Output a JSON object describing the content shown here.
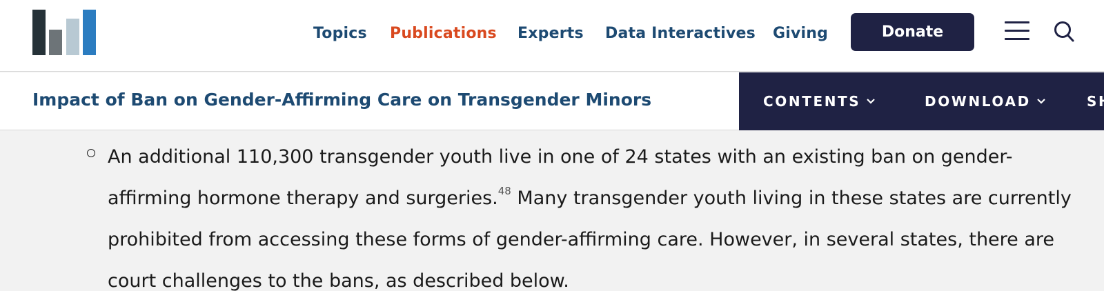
{
  "header": {
    "nav": [
      {
        "label": "Topics",
        "active": false
      },
      {
        "label": "Publications",
        "active": true
      },
      {
        "label": "Experts",
        "active": false
      },
      {
        "label": "Data Interactives",
        "active": false
      },
      {
        "label": "Giving",
        "active": false
      }
    ],
    "donate_label": "Donate",
    "icons": [
      "logo",
      "hamburger-menu-icon",
      "search-icon"
    ]
  },
  "subheader": {
    "title": "Impact of Ban on Gender-Affirming Care on Transgender Minors",
    "actions": [
      {
        "label": "CONTENTS"
      },
      {
        "label": "DOWNLOAD"
      },
      {
        "label": "SH"
      }
    ]
  },
  "content": {
    "bullet_text_1": "An additional 110,300 transgender youth live in one of 24 states with an existing ban on gender-affirming hormone therapy and surgeries.",
    "footnote": "48",
    "bullet_text_2": " Many transgender youth living in these states are currently prohibited from accessing these forms of gender-affirming care. However, in several states, there are court challenges to the bans, as described below."
  },
  "colors": {
    "nav_text": "#1d4a72",
    "nav_active": "#d9491f",
    "brand_navy": "#1f2244",
    "page_bg": "#f2f2f2",
    "logo_bars": [
      "#263238",
      "#6d7478",
      "#b8c9d3",
      "#2b7cc0"
    ]
  }
}
